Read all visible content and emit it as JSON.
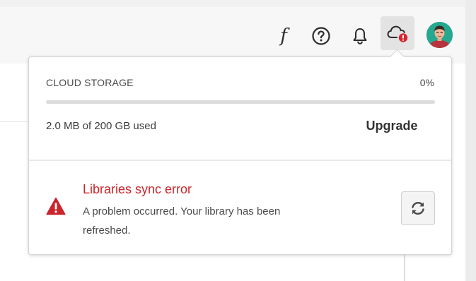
{
  "header": {
    "icons": {
      "fonts": "fonts-icon",
      "help": "help-icon",
      "notifications": "bell-icon",
      "cloud_sync": "cloud-error-icon",
      "avatar": "user-avatar"
    },
    "fonts_glyph": "f"
  },
  "cloud_panel": {
    "storage_title": "CLOUD STORAGE",
    "storage_percent": "0%",
    "storage_used_fraction": 0.0,
    "storage_used_text": "2.0 MB of 200 GB used",
    "upgrade_label": "Upgrade",
    "error": {
      "title": "Libraries sync error",
      "message": "A problem occurred. Your library has been refreshed.",
      "icon": "alert-triangle-icon",
      "refresh_icon": "refresh-icon"
    }
  },
  "colors": {
    "error_red": "#c9252c",
    "progress_fill": "#2680eb",
    "progress_track": "#dcdcdc",
    "avatar_bg": "#24a890"
  }
}
